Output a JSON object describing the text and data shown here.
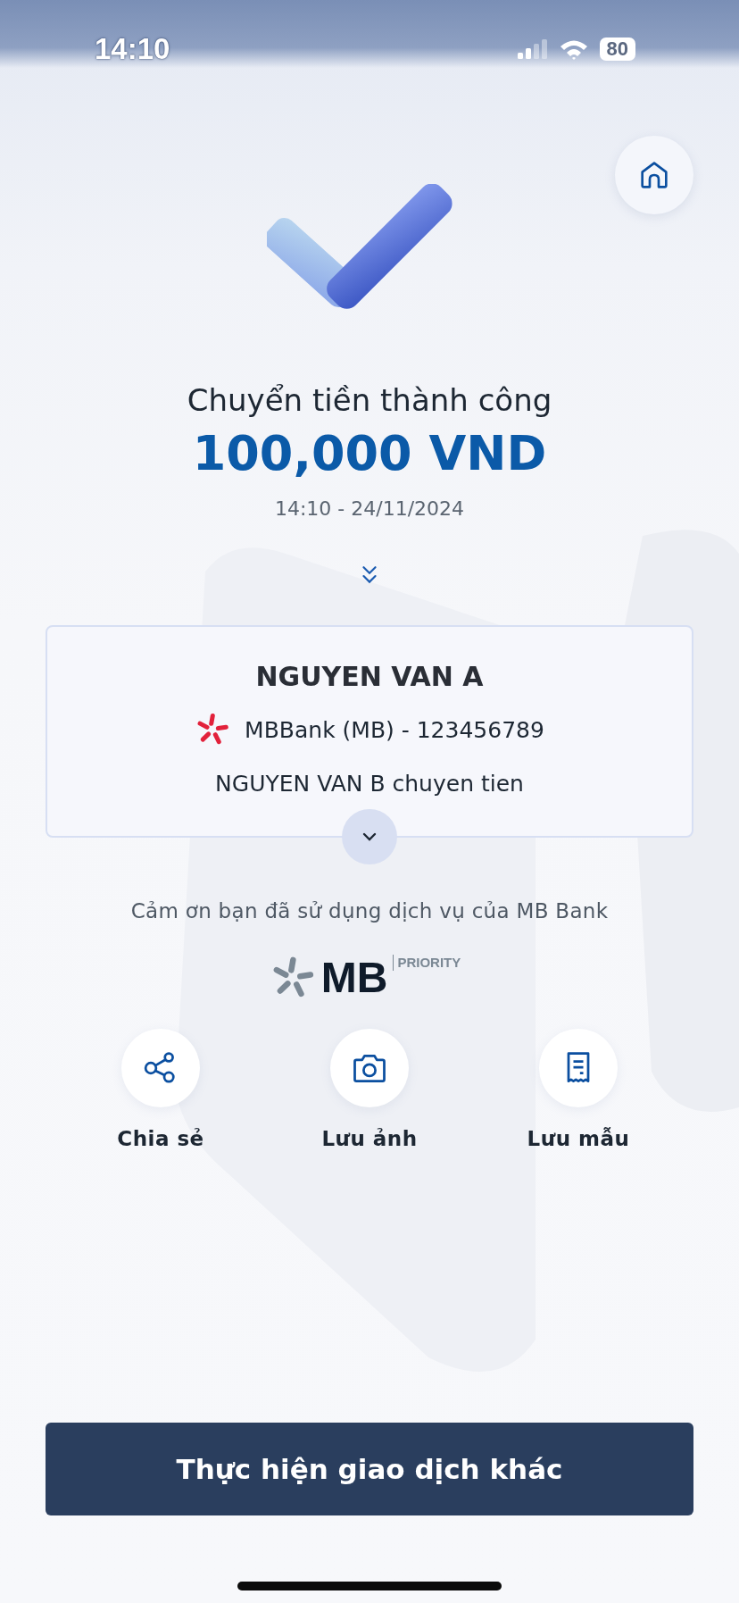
{
  "status_bar": {
    "time": "14:10",
    "battery": "80"
  },
  "result": {
    "title": "Chuyển tiền thành công",
    "amount": "100,000 VND",
    "datetime": "14:10 - 24/11/2024"
  },
  "recipient": {
    "name": "NGUYEN VAN A",
    "bank": "MBBank (MB) - 123456789",
    "memo": "NGUYEN VAN B chuyen tien"
  },
  "thanks": "Cảm ơn bạn đã sử dụng dịch vụ của MB Bank",
  "logo": {
    "brand": "MB",
    "tier": "PRIORITY"
  },
  "actions": [
    {
      "kind": "share",
      "label": "Chia sẻ"
    },
    {
      "kind": "camera",
      "label": "Lưu ảnh"
    },
    {
      "kind": "receipt",
      "label": "Lưu mẫu"
    }
  ],
  "primary_button": "Thực hiện giao dịch khác"
}
